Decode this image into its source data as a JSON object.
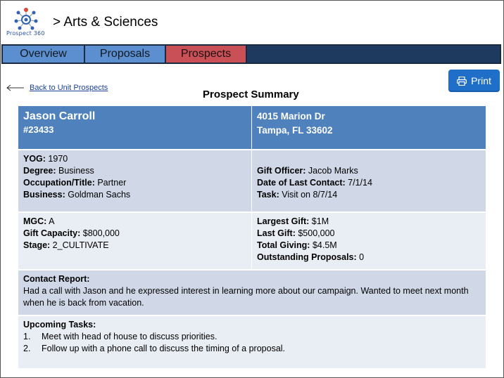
{
  "header": {
    "logo_text": "Prospect 360",
    "title": "> Arts & Sciences"
  },
  "nav": {
    "tabs": [
      {
        "label": "Overview"
      },
      {
        "label": "Proposals"
      },
      {
        "label": "Prospects",
        "active": true
      }
    ]
  },
  "colors": {
    "tab_inactive": "#5b8fd0",
    "tab_active": "#c85056",
    "nav_bg": "#1f3a5f",
    "card_header": "#4f81bd",
    "row_dark": "#d0d8e8",
    "row_light": "#e9edf4",
    "print_button": "#1f6ec8"
  },
  "print_button": {
    "label": "Print",
    "icon": "printer-icon"
  },
  "back_link": {
    "label": "Back to Unit Prospects",
    "icon": "arrow-left-icon"
  },
  "summary_title": "Prospect Summary",
  "prospect": {
    "name": "Jason Carroll",
    "id": "#23433",
    "address_line1": "4015 Marion  Dr",
    "address_line2": "Tampa,  FL 33602",
    "yog_label": "YOG:",
    "yog": " 1970",
    "degree_label": "Degree:",
    "degree": " Business",
    "occupation_label": "Occupation/Title:",
    "occupation": " Partner",
    "business_label": "Business:",
    "business": " Goldman Sachs",
    "gift_officer_label": "Gift Officer:",
    "gift_officer": " Jacob Marks",
    "last_contact_label": "Date of Last Contact:",
    "last_contact": " 7/1/14",
    "task_label": "Task:",
    "task": " Visit on 8/7/14",
    "mgc_label": "MGC:",
    "mgc": " A",
    "gift_capacity_label": "Gift Capacity:",
    "gift_capacity": " $800,000",
    "stage_label": "Stage:",
    "stage": " 2_CULTIVATE",
    "largest_gift_label": "Largest Gift:",
    "largest_gift": " $1M",
    "last_gift_label": "Last Gift:",
    "last_gift": " $500,000",
    "total_giving_label": "Total Giving:",
    "total_giving": " $4.5M",
    "outstanding_label": "Outstanding Proposals:",
    "outstanding": " 0"
  },
  "contact_report": {
    "label": "Contact Report:",
    "text": "Had a call with Jason and he expressed interest in learning more about our campaign. Wanted to meet next month when he is back from vacation."
  },
  "upcoming_tasks": {
    "label": "Upcoming Tasks:",
    "items": [
      {
        "num": "1.",
        "text": "Meet with head of house to discuss priorities."
      },
      {
        "num": "2.",
        "text": "Follow up with a phone call to discuss the timing of a proposal."
      }
    ]
  }
}
